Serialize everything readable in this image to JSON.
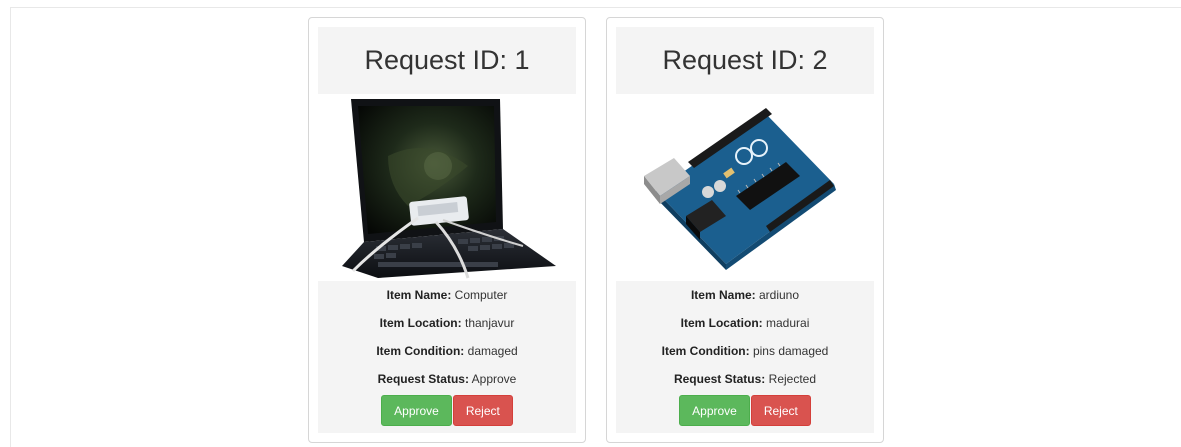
{
  "requests": [
    {
      "title": "Request ID: 1",
      "image_icon": "laptop-image",
      "labels": {
        "name": "Item Name:",
        "location": "Item Location:",
        "condition": "Item Condition:",
        "status": "Request Status:"
      },
      "item_name": "Computer",
      "item_location": "thanjavur",
      "item_condition": "damaged",
      "request_status": "Approve",
      "approve_label": "Approve",
      "reject_label": "Reject"
    },
    {
      "title": "Request ID: 2",
      "image_icon": "arduino-board-image",
      "labels": {
        "name": "Item Name:",
        "location": "Item Location:",
        "condition": "Item Condition:",
        "status": "Request Status:"
      },
      "item_name": "ardiuno",
      "item_location": "madurai",
      "item_condition": "pins damaged",
      "request_status": "Rejected",
      "approve_label": "Approve",
      "reject_label": "Reject"
    }
  ],
  "colors": {
    "approve": "#5cb85c",
    "reject": "#d9534f",
    "panel": "#f4f4f4"
  }
}
